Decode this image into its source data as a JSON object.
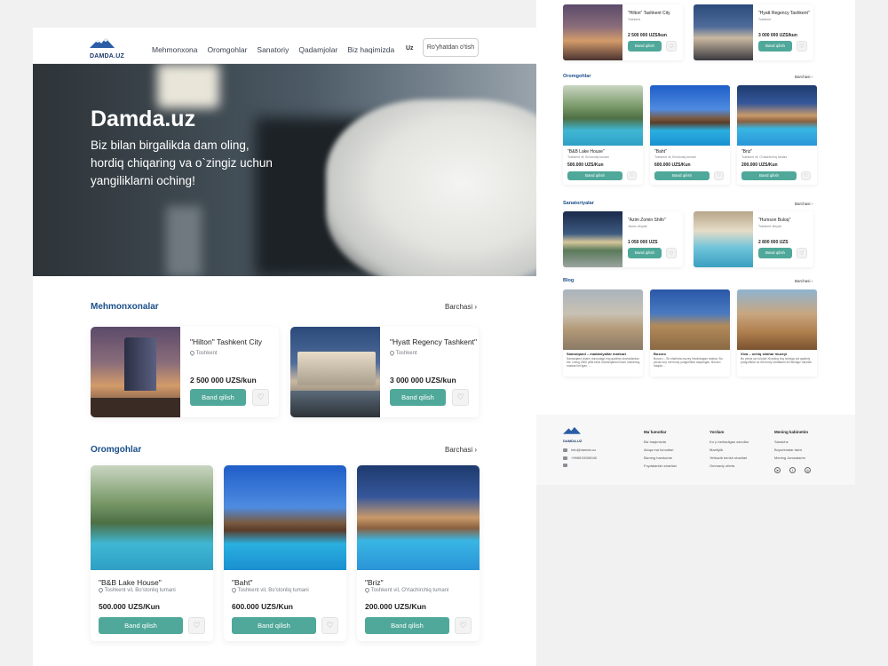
{
  "brand": {
    "name": "DAMDA.UZ"
  },
  "nav": {
    "items": [
      "Mehmonxona",
      "Oromgohlar",
      "Sanatoriy",
      "Qadamjolar",
      "Biz haqimizda"
    ],
    "lang": "Uz",
    "signin": "Ro'yhatdan o'tish"
  },
  "hero": {
    "title": "Damda.uz",
    "subtitle": "Biz bilan birgalikda dam oling, hordiq chiqaring va o`zingiz uchun yangiliklarni oching!"
  },
  "common": {
    "see_all": "Barchasi",
    "book": "Band qilish"
  },
  "hotels": {
    "heading": "Mehmonxonalar",
    "items": [
      {
        "name": "\"Hilton\" Tashkent City",
        "location": "Toshkent",
        "price": "2 500 000 UZS/kun"
      },
      {
        "name": "\"Hyatt Regency Tashkent\"",
        "location": "Toshkent",
        "price": "3 000 000 UZS/kun"
      }
    ]
  },
  "resorts": {
    "heading": "Oromgohlar",
    "items": [
      {
        "name": "\"B&B Lake House\"",
        "location": "Toshkent vil, Bo'stonliq tumani",
        "price": "500.000 UZS/Kun"
      },
      {
        "name": "\"Baht\"",
        "location": "Toshkent vil, Bo'stonliq tumani",
        "price": "600.000 UZS/Kun"
      },
      {
        "name": "\"Briz\"",
        "location": "Toshkent vil, O'rtachirchiq tumani",
        "price": "200.000 UZS/Kun"
      }
    ]
  },
  "sanatoriums": {
    "heading": "Sanatoriyalar",
    "items": [
      {
        "name": "\"Azim Zomin Shifo\"",
        "location": "Jizzax viloyati",
        "price": "1 050 000 UZS"
      },
      {
        "name": "\"Humson Buloq\"",
        "location": "Toshkent viloyati",
        "price": "2 800 000 UZS"
      }
    ]
  },
  "blog": {
    "heading": "Blog",
    "items": [
      {
        "title": "Samarqand – madaniyatlar markazi",
        "excerpt": "Samarqand shahri dunyodagi eng qadimiy shaharlardan biri. Uning 2500 yillik tarixi Samarqandni islom olamining markazi bo'lgan, ..."
      },
      {
        "title": "Buxoro",
        "excerpt": "Buxoro – Sir shahrida muzey hisoblangan shahar. Bu yerda ko'p me'moriy yodgorliklar saqlangan. Buxoro haqida ..."
      },
      {
        "title": "Xiva – ochiq shahar muzeyi",
        "excerpt": "Bu yerda siz ko'plab Xivaning boy tarixiga oid qadimiy yodgorliklar va me'moriy obidalarni ko'rishingiz mumkin ..."
      }
    ]
  },
  "footer": {
    "email": "info@damda.uz",
    "phone": "+998915008040",
    "columns": [
      {
        "title": "Ma`lumotlar",
        "items": [
          "Biz haqimizda",
          "Aloqa ma`lumotlari",
          "Bizning hamkorlar",
          "Foydalanish shartlari"
        ]
      },
      {
        "title": "Yordam",
        "items": [
          "Ko`p beriladigan savollar",
          "Maxfiylik",
          "Yetkazib berish shartlari",
          "Ommaviy oferta"
        ]
      },
      {
        "title": "Mening kabinetim",
        "items": [
          "Saralchs",
          "Buyurtmalar tarixi",
          "Mening Jamoalarim"
        ]
      }
    ]
  },
  "colors": {
    "accent": "#4fa899",
    "heading": "#1a4e8a",
    "brand": "#1d3a66"
  }
}
